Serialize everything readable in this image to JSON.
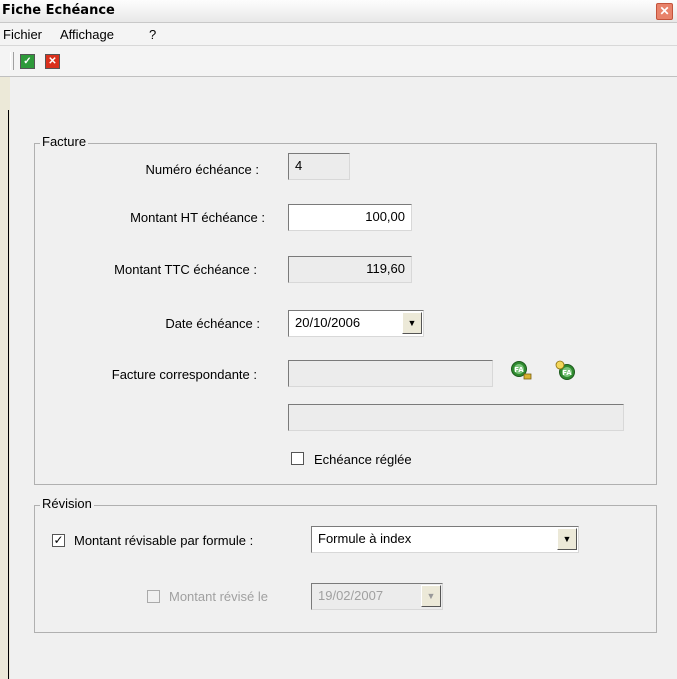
{
  "window": {
    "title": "Fiche Echéance",
    "close_glyph": "✕"
  },
  "menu": [
    "Fichier",
    "Affichage",
    "?"
  ],
  "toolbar": {
    "ok_icon": "✓",
    "cancel_icon": "✕"
  },
  "facture": {
    "legend": "Facture",
    "numero_label": "Numéro échéance :",
    "numero_value": "4",
    "montant_ht_label": "Montant HT échéance :",
    "montant_ht_value": "100,00",
    "montant_ttc_label": "Montant TTC échéance :",
    "montant_ttc_value": "119,60",
    "date_label": "Date échéance :",
    "date_value": "20/10/2006",
    "facture_label": "Facture correspondante :",
    "facture_value": "",
    "facture_detail": "",
    "reglee_label": "Echéance réglée",
    "reglee_checked": false
  },
  "revision": {
    "legend": "Révision",
    "revisable_label": "Montant révisable par formule :",
    "revisable_checked": true,
    "formule_value": "Formule à index",
    "revise_label": "Montant révisé le",
    "revise_checked": false,
    "revise_date": "19/02/2007"
  },
  "icons": {
    "dropdown": "▼",
    "check": "✓"
  }
}
